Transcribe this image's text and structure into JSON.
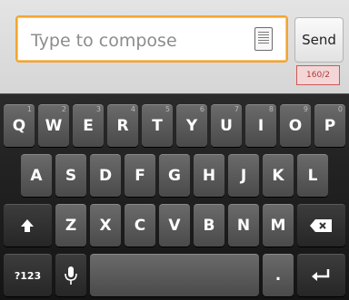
{
  "compose": {
    "placeholder": "Type to compose",
    "send_label": "Send",
    "char_counter": "160/2"
  },
  "keyboard": {
    "row1": [
      {
        "label": "Q",
        "hint": "1"
      },
      {
        "label": "W",
        "hint": "2"
      },
      {
        "label": "E",
        "hint": "3"
      },
      {
        "label": "R",
        "hint": "4"
      },
      {
        "label": "T",
        "hint": "5"
      },
      {
        "label": "Y",
        "hint": "6"
      },
      {
        "label": "U",
        "hint": "7"
      },
      {
        "label": "I",
        "hint": "8"
      },
      {
        "label": "O",
        "hint": "9"
      },
      {
        "label": "P",
        "hint": "0"
      }
    ],
    "row2": [
      "A",
      "S",
      "D",
      "F",
      "G",
      "H",
      "J",
      "K",
      "L"
    ],
    "row3": [
      "Z",
      "X",
      "C",
      "V",
      "B",
      "N",
      "M"
    ],
    "symbols_label": "?123",
    "icons": {
      "shift": "shift-icon",
      "delete": "backspace-icon",
      "mic": "microphone-icon",
      "enter": "enter-icon",
      "attach": "attach-icon"
    },
    "period_label": "."
  }
}
